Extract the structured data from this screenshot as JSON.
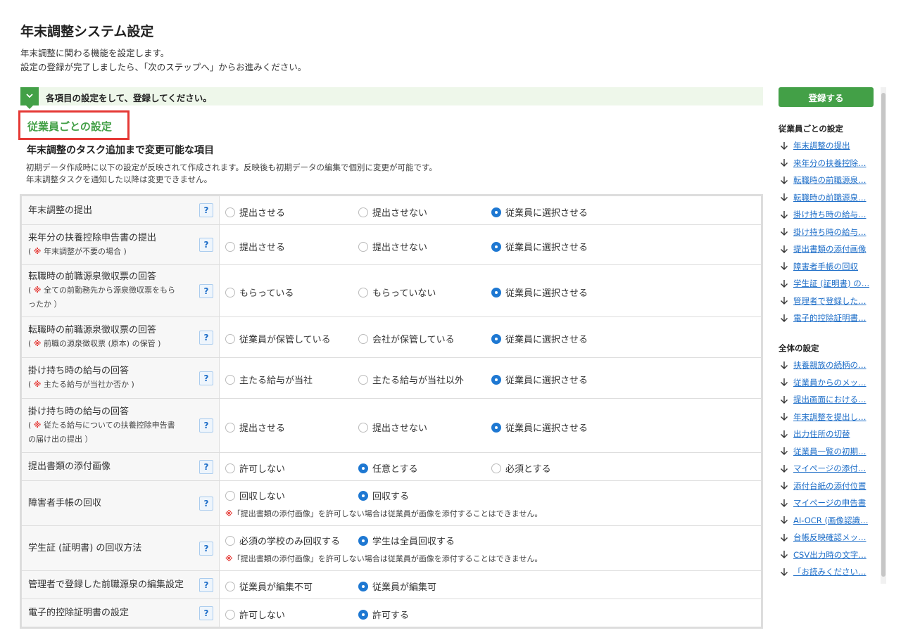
{
  "page": {
    "title": "年末調整システム設定",
    "intro_line1": "年末調整に関わる機能を設定します。",
    "intro_line2": "設定の登録が完了しましたら、「次のステップへ」からお進みください。"
  },
  "notice": {
    "text": "各項目の設定をして、登録してください。"
  },
  "section": {
    "title": "従業員ごとの設定",
    "subheading": "年末調整のタスク追加まで変更可能な項目",
    "desc_line1": "初期データ作成時に以下の設定が反映されて作成されます。反映後も初期データの編集で個別に変更が可能です。",
    "desc_line2": "年末調整タスクを通知した以降は変更できません。"
  },
  "help_label": "?",
  "note_mark": "※",
  "rows": [
    {
      "label": "年末調整の提出",
      "options": [
        "提出させる",
        "提出させない",
        "従業員に選択させる"
      ],
      "selected": 2
    },
    {
      "label": "来年分の扶養控除申告書の提出",
      "sub": "年末調整が不要の場合",
      "options": [
        "提出させる",
        "提出させない",
        "従業員に選択させる"
      ],
      "selected": 2
    },
    {
      "label": "転職時の前職源泉徴収票の回答",
      "sub1": "全ての前勤務先から源泉徴収票をもら",
      "sub2": "ったか ）",
      "options": [
        "もらっている",
        "もらっていない",
        "従業員に選択させる"
      ],
      "selected": 2
    },
    {
      "label": "転職時の前職源泉徴収票の回答",
      "sub": "前職の源泉徴収票 (原本) の保管",
      "options": [
        "従業員が保管している",
        "会社が保管している",
        "従業員に選択させる"
      ],
      "selected": 2
    },
    {
      "label": "掛け持ち時の給与の回答",
      "sub": "主たる給与が当社か否か",
      "options": [
        "主たる給与が当社",
        "主たる給与が当社以外",
        "従業員に選択させる"
      ],
      "selected": 2
    },
    {
      "label": "掛け持ち時の給与の回答",
      "sub1": "従たる給与についての扶養控除申告書",
      "sub2": "の届け出の提出 ）",
      "options": [
        "提出させる",
        "提出させない",
        "従業員に選択させる"
      ],
      "selected": 2
    },
    {
      "label": "提出書類の添付画像",
      "options": [
        "許可しない",
        "任意とする",
        "必須とする"
      ],
      "selected": 1
    },
    {
      "label": "障害者手帳の回収",
      "options": [
        "回収しない",
        "回収する"
      ],
      "selected": 1,
      "note": "「提出書類の添付画像」を許可しない場合は従業員が画像を添付することはできません。"
    },
    {
      "label": "学生証 (証明書) の回収方法",
      "options": [
        "必須の学校のみ回収する",
        "学生は全員回収する"
      ],
      "selected": 1,
      "note": "「提出書類の添付画像」を許可しない場合は従業員が画像を添付することはできません。"
    },
    {
      "label": "管理者で登録した前職源泉の編集設定",
      "options": [
        "従業員が編集不可",
        "従業員が編集可"
      ],
      "selected": 1
    },
    {
      "label": "電子的控除証明書の設定",
      "options": [
        "許可しない",
        "許可する"
      ],
      "selected": 1
    }
  ],
  "sidebar": {
    "register_label": "登録する",
    "group1_heading": "従業員ごとの設定",
    "group1": [
      "年末調整の提出",
      "来年分の扶養控除…",
      "転職時の前職源泉…",
      "転職時の前職源泉…",
      "掛け持ち時の給与…",
      "掛け持ち時の給与…",
      "提出書類の添付画像",
      "障害者手帳の回収",
      "学生証 (証明書) の…",
      "管理者で登録した…",
      "電子的控除証明書…"
    ],
    "group2_heading": "全体の設定",
    "group2": [
      "扶養親族の続柄の…",
      "従業員からのメッ…",
      "提出画面における…",
      "年末調整を提出し…",
      "出力住所の切替",
      "従業員一覧の初期…",
      "マイページの添付…",
      "添付台紙の添付位置",
      "マイページの申告書",
      "AI-OCR (画像認識…",
      "台帳反映確認メッ…",
      "CSV出力時の文字…",
      "「お読みください…"
    ]
  },
  "colors": {
    "accent_green": "#43a047",
    "radio_blue": "#1e78d2",
    "link_blue": "#1e6ec8",
    "highlight_red": "#e53935"
  }
}
